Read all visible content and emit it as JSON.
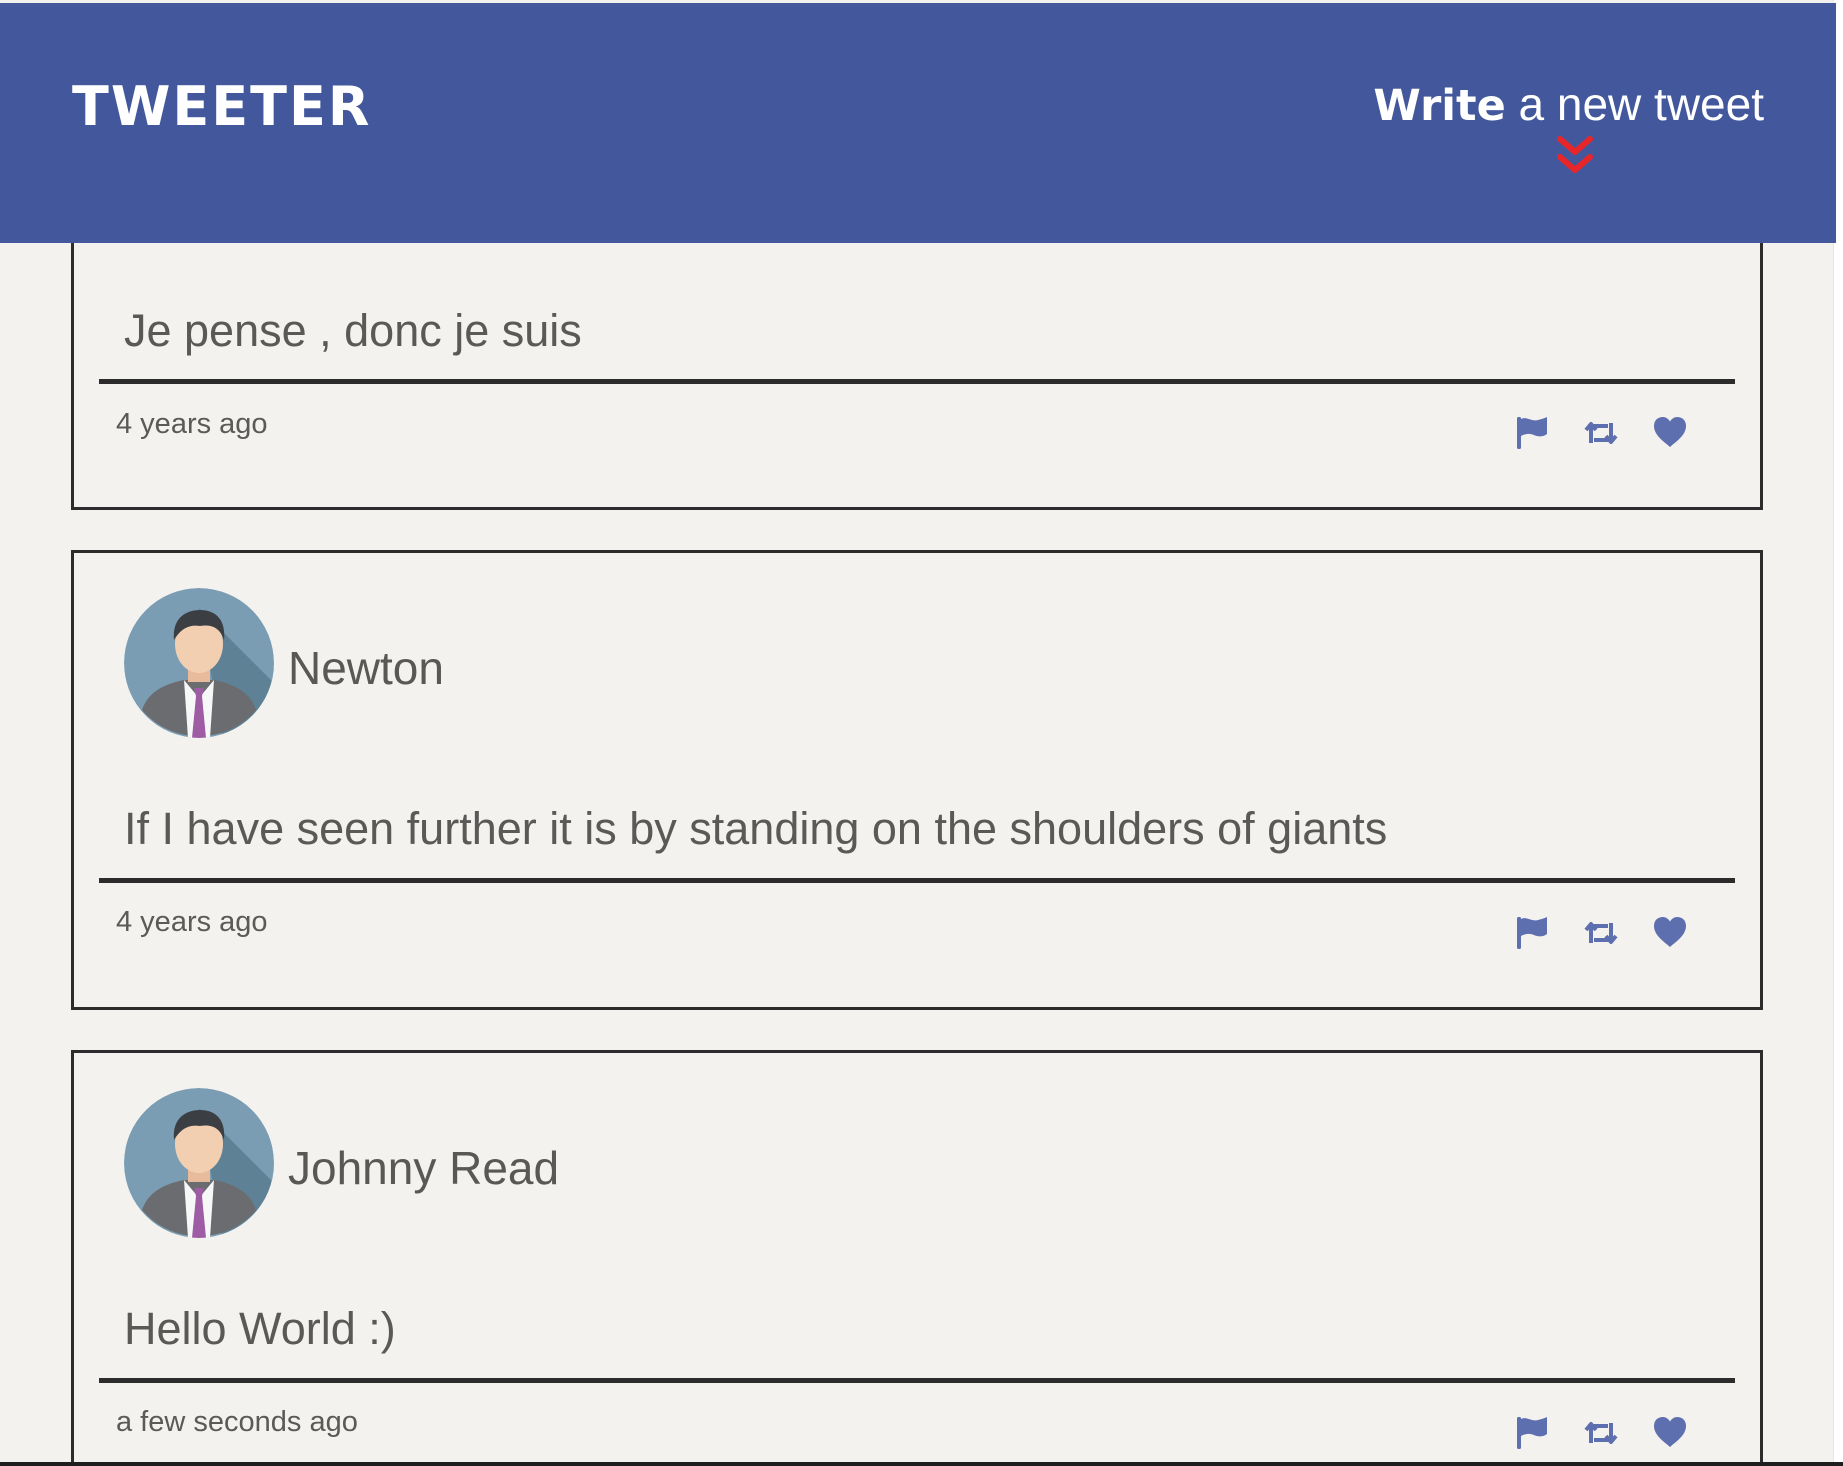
{
  "header": {
    "brand": "TWEETER",
    "compose_bold": "Write",
    "compose_rest": " a new tweet",
    "compose_arrow_icon": "double-chevron-down-icon",
    "accent_color": "#e8262a",
    "bar_color": "#43589c"
  },
  "tweets": [
    {
      "author": "",
      "text": "Je pense , donc je suis",
      "time": "4 years ago",
      "actions": [
        "flag-icon",
        "retweet-icon",
        "heart-icon"
      ]
    },
    {
      "author": "Newton",
      "text": "If I have seen further it is by standing on the shoulders of giants",
      "time": "4 years ago",
      "actions": [
        "flag-icon",
        "retweet-icon",
        "heart-icon"
      ]
    },
    {
      "author": "Johnny Read",
      "text": "Hello World :)",
      "time": "a few seconds ago",
      "actions": [
        "flag-icon",
        "retweet-icon",
        "heart-icon"
      ]
    }
  ],
  "icon_color": "#5d6fae"
}
